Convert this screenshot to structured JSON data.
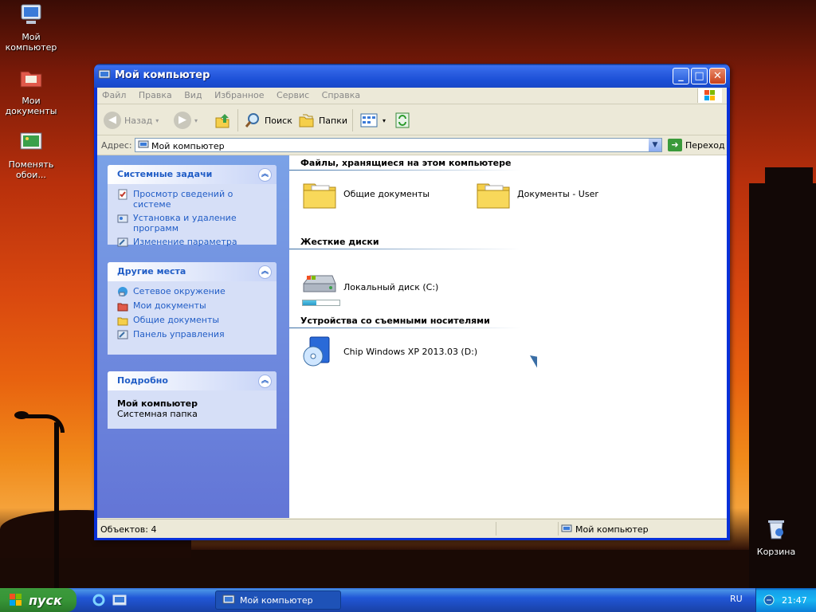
{
  "desktop": {
    "icons": [
      {
        "label_line1": "Мой",
        "label_line2": "компьютер"
      },
      {
        "label_line1": "Мои",
        "label_line2": "документы"
      },
      {
        "label_line1": "Поменять",
        "label_line2": "обои..."
      },
      {
        "label_line1": "Корзина",
        "label_line2": ""
      }
    ]
  },
  "window": {
    "title": "Мой компьютер",
    "menu": [
      "Файл",
      "Правка",
      "Вид",
      "Избранное",
      "Сервис",
      "Справка"
    ],
    "toolbar": {
      "back": "Назад",
      "search": "Поиск",
      "folders": "Папки"
    },
    "address": {
      "label": "Адрес:",
      "value": "Мой компьютер",
      "go": "Переход"
    },
    "left": {
      "system_tasks": {
        "title": "Системные задачи",
        "links": [
          "Просмотр сведений о системе",
          "Установка и удаление программ",
          "Изменение параметра"
        ]
      },
      "other_places": {
        "title": "Другие места",
        "links": [
          "Сетевое окружение",
          "Мои документы",
          "Общие документы",
          "Панель управления"
        ]
      },
      "details": {
        "title": "Подробно",
        "name": "Мой компьютер",
        "type": "Системная папка"
      }
    },
    "groups": [
      {
        "title": "Файлы, хранящиеся на этом компьютере",
        "items": [
          "Общие документы",
          "Документы - User"
        ]
      },
      {
        "title": "Жесткие диски",
        "items": [
          "Локальный диск (C:)"
        ]
      },
      {
        "title": "Устройства со съемными носителями",
        "items": [
          "Chip Windows XP 2013.03 (D:)"
        ]
      }
    ],
    "status": {
      "objects": "Объектов: 4",
      "location": "Мой компьютер"
    }
  },
  "taskbar": {
    "start": "пуск",
    "task": "Мой компьютер",
    "lang": "RU",
    "clock": "21:47"
  },
  "colors": {
    "title_blue": "#2a5de0",
    "link_blue": "#215dc6",
    "start_green": "#379537"
  }
}
